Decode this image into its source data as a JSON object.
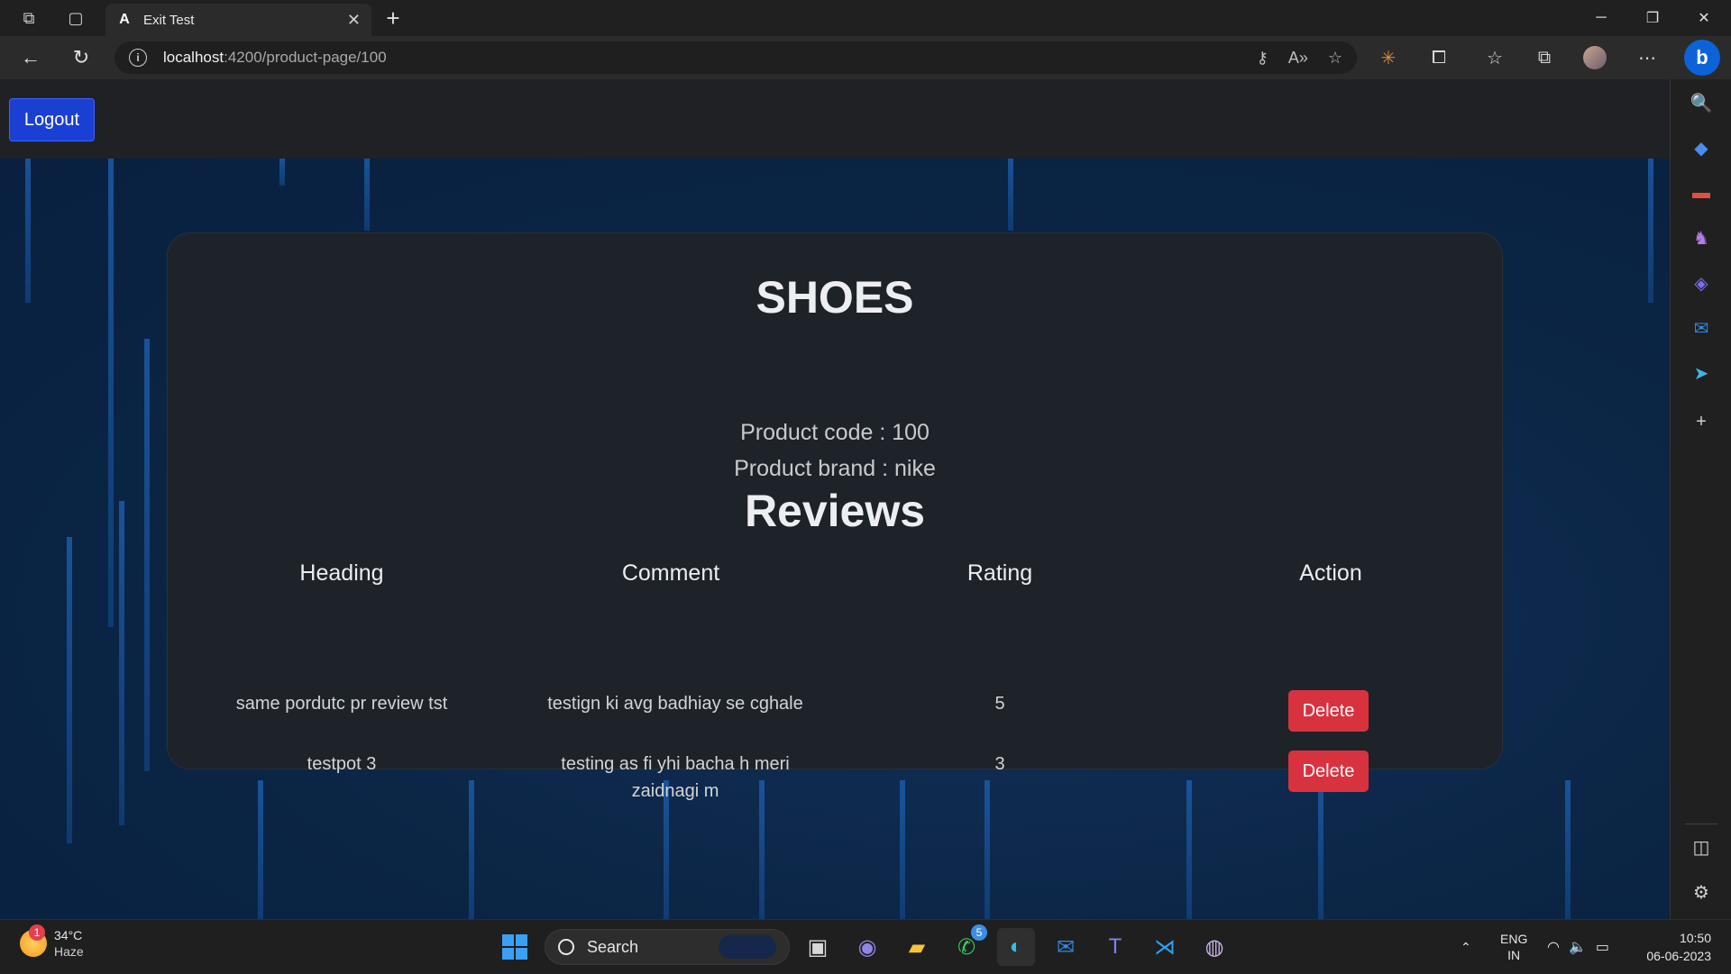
{
  "browser": {
    "tab_title": "Exit Test",
    "tab_favicon": "A",
    "url_host": "localhost",
    "url_path": ":4200/product-page/100"
  },
  "header": {
    "logout_label": "Logout"
  },
  "product": {
    "name": "SHOES",
    "code_line": "Product code : 100",
    "brand_line": "Product brand : nike"
  },
  "reviews": {
    "title": "Reviews",
    "columns": [
      "Heading",
      "Comment",
      "Rating",
      "Action"
    ],
    "rows": [
      {
        "heading": "same pordutc pr review tst",
        "comment": "testign ki avg badhiay se cghale",
        "rating": "5",
        "action": "Delete"
      },
      {
        "heading": "testpot 3",
        "comment": "testing as fi yhi bacha h meri zaidnagi m",
        "rating": "3",
        "action": "Delete"
      }
    ]
  },
  "taskbar": {
    "weather_temp": "34°C",
    "weather_desc": "Haze",
    "weather_badge": "1",
    "search_label": "Search",
    "whatsapp_badge": "5",
    "lang_line1": "ENG",
    "lang_line2": "IN",
    "time": "10:50",
    "date": "06-06-2023"
  },
  "colors": {
    "accent_button": "#1a3fd3",
    "delete_button": "#d9323f",
    "page_background": "#0b2442",
    "card_background": "#1e2229"
  }
}
